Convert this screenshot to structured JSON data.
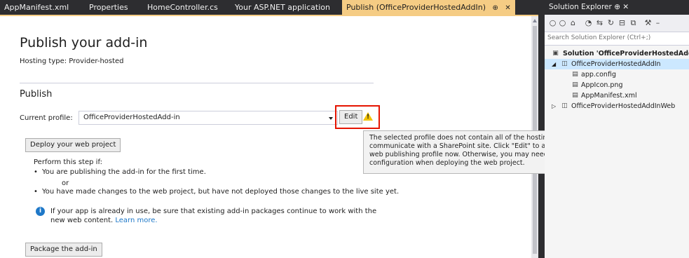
{
  "tabs": [
    {
      "label": "AppManifest.xml"
    },
    {
      "label": "Properties"
    },
    {
      "label": "HomeController.cs"
    },
    {
      "label": "Your ASP.NET application"
    },
    {
      "label": "Publish (OfficeProviderHostedAddIn)",
      "pin": "⊕",
      "close": "✕"
    }
  ],
  "page": {
    "title": "Publish your add-in",
    "hosting_type": "Hosting type: Provider-hosted",
    "section_title": "Publish",
    "current_profile_label": "Current profile:",
    "current_profile_value": "OfficeProviderHostedAdd-in",
    "edit_label": "Edit",
    "warning_mark": "!",
    "tooltip_text": "The selected profile does not contain all of the hosting information required to communicate with a SharePoint site. Click \"Edit\" to add this information to the web publishing profile now. Otherwise, you may need to do additional configuration when deploying the web project.",
    "deploy_label": "Deploy your web project",
    "perform_label": "Perform this step if:",
    "bullet_1": "You are publishing the add-in for the first time.",
    "or_label": "or",
    "bullet_2": "You have made changes to the web project, but have not deployed those changes to the live site yet.",
    "bullet_char": "•",
    "info_icon_char": "i",
    "info_text": "If your app is already in use, be sure that existing add-in packages continue to work with the new web content.",
    "learn_more": "Learn more.",
    "package_label": "Package the add-in"
  },
  "solution_explorer": {
    "title": "Solution Explorer",
    "title_pin": "⊕",
    "title_close": "✕",
    "search_placeholder": "Search Solution Explorer (Ctrl+;)",
    "toolbar_icons": [
      "back-icon",
      "forward-icon",
      "home-icon",
      "history-icon",
      "sync-icon",
      "refresh-icon",
      "collapse-icon",
      "show-all-files-icon",
      "properties-icon"
    ],
    "tree": [
      {
        "label": "Solution 'OfficeProviderHostedAddIn'",
        "icon": "solution-icon"
      },
      {
        "label": "OfficeProviderHostedAddIn",
        "icon": "project-icon"
      },
      {
        "label": "app.config",
        "icon": "config-file-icon"
      },
      {
        "label": "AppIcon.png",
        "icon": "image-file-icon"
      },
      {
        "label": "AppManifest.xml",
        "icon": "manifest-file-icon"
      },
      {
        "label": "OfficeProviderHostedAddInWeb",
        "icon": "web-project-icon"
      }
    ],
    "tree_glyphs": {
      "solution": "▣",
      "project": "◫",
      "file": "▤",
      "expanded": "◢",
      "collapsed": "▷"
    }
  },
  "colors": {
    "accent_tab": "#f5cc84",
    "highlight_border": "#e51400",
    "warning": "#f2c200",
    "link": "#1e78c8",
    "selection": "#cce8ff"
  }
}
